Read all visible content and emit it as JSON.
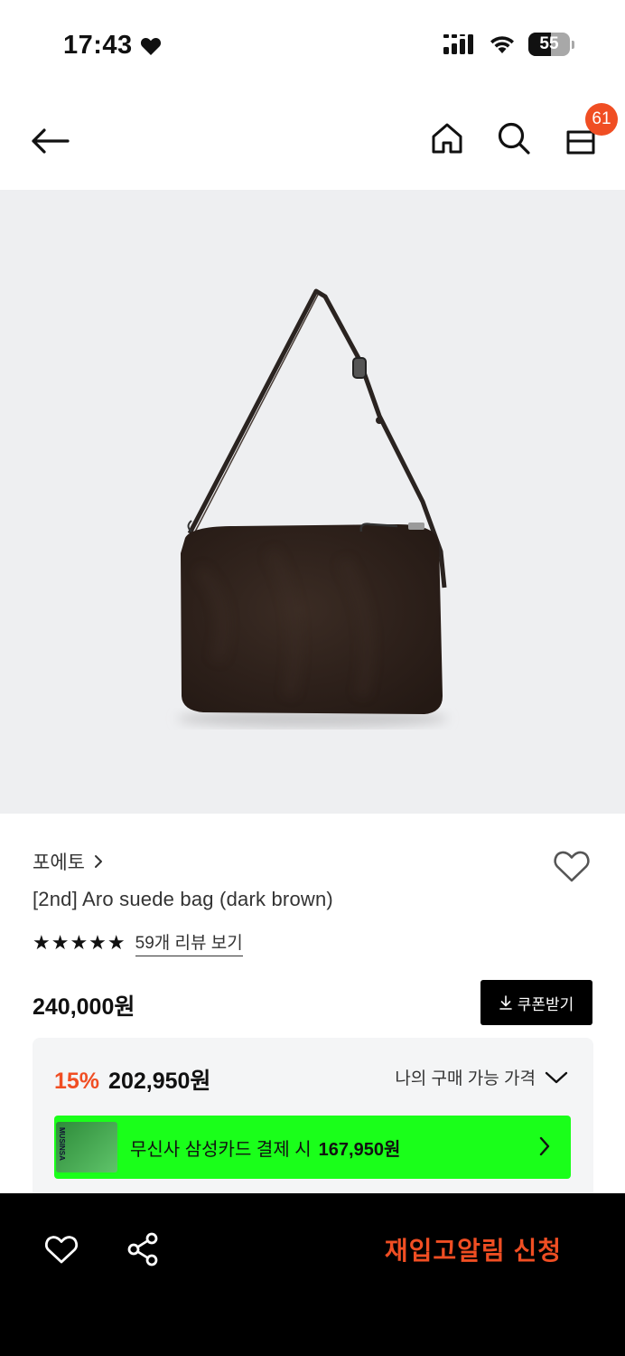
{
  "status_bar": {
    "time": "17:43",
    "battery": "55"
  },
  "nav": {
    "cart_count": "61"
  },
  "product": {
    "brand": "포에토",
    "name": "[2nd] Aro suede bag (dark brown)",
    "stars": "★★★★★",
    "review_link": "59개 리뷰 보기",
    "price": "240,000원",
    "coupon_label": "쿠폰받기",
    "discount_rate": "15%",
    "sale_price": "202,950원",
    "my_price_label": "나의 구매 가능 가격",
    "card_offer_text": "무신사 삼성카드 결제 시",
    "card_offer_price": "167,950원",
    "card_thumb_text": "MUSINSA"
  },
  "bottom": {
    "restock_label": "재입고알림 신청"
  },
  "colors": {
    "accent": "#f04e23",
    "banner_green": "#1aff1a",
    "image_bg": "#eeeff1"
  }
}
